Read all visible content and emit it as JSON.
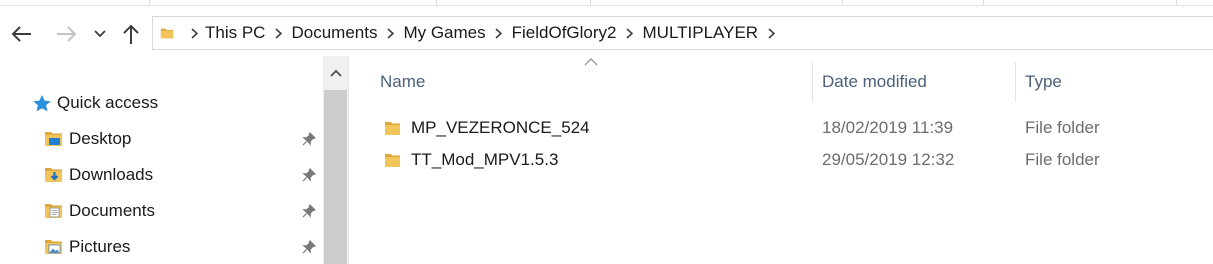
{
  "window": {
    "colors": {
      "accent": "#2b6cd8",
      "folder": "#f2c55c",
      "folder_dark": "#dca93a",
      "pin": "#7a7a7a"
    }
  },
  "navigation": {
    "back_icon": "arrow-left-icon",
    "forward_icon": "arrow-right-icon",
    "recent_icon": "chevron-down-icon",
    "up_icon": "arrow-up-icon"
  },
  "address_bar": {
    "breadcrumbs": [
      {
        "label": "This PC"
      },
      {
        "label": "Documents"
      },
      {
        "label": "My Games"
      },
      {
        "label": "FieldOfGlory2"
      },
      {
        "label": "MULTIPLAYER"
      }
    ]
  },
  "sidebar": {
    "quick_access": {
      "label": "Quick access",
      "icon": "star-icon"
    },
    "items": [
      {
        "label": "Desktop",
        "icon": "desktop-folder-icon",
        "pinned": true
      },
      {
        "label": "Downloads",
        "icon": "downloads-folder-icon",
        "pinned": true
      },
      {
        "label": "Documents",
        "icon": "documents-folder-icon",
        "pinned": true
      },
      {
        "label": "Pictures",
        "icon": "pictures-folder-icon",
        "pinned": true
      }
    ]
  },
  "file_list": {
    "columns": {
      "name": "Name",
      "date": "Date modified",
      "type": "Type"
    },
    "sort_indicator": "sort-ascending-caret",
    "rows": [
      {
        "name": "MP_VEZERONCE_524",
        "date": "18/02/2019 11:39",
        "type": "File folder"
      },
      {
        "name": "TT_Mod_MPV1.5.3",
        "date": "29/05/2019 12:32",
        "type": "File folder"
      }
    ]
  }
}
